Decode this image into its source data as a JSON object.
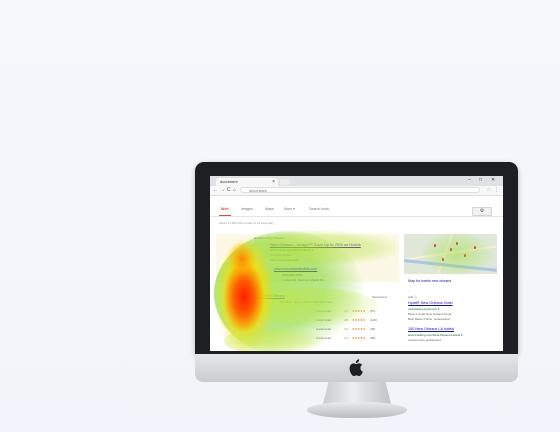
{
  "browser": {
    "tab_title": "document",
    "address": "about:blank",
    "nav_buttons": {
      "back": "←",
      "forward": "→",
      "reload": "C",
      "home": "⌂"
    },
    "window_controls": {
      "minimize": "–",
      "maximize": "□",
      "close": "✕"
    },
    "tab_close": "×",
    "bookmark_icon": "star-icon",
    "menu_icon": "⋮"
  },
  "search": {
    "tabs": [
      "Web",
      "Images",
      "Maps",
      "More ▾",
      "Search tools"
    ],
    "active_tab": "Web",
    "stats": "About 71,000,000 results (0.41 seconds)",
    "gear_icon": "⚙"
  },
  "ad": {
    "header": "Hotels in New Orleans",
    "title": "New Orleans - trivago™ Save Up to 75% on Hotels",
    "url_line": "www.trivago.com/New-Orleans ▾",
    "desc_1": "Compare Hotels",
    "desc_2": "Find your Ideal Hotel!",
    "site": "www.neworleanshotels.com",
    "phone": "(800) 805-5760",
    "address": "1 Hotel Rd, Starting At $119 NL"
  },
  "results": {
    "header": "Hotels in New Orleans",
    "sponsored": "Sponsored",
    "desc": "All hotels, prices, Street View and more",
    "rows": [
      {
        "label": "4-star hotel",
        "rating": "4.4",
        "stars": "★★★★★",
        "count": "(57)"
      },
      {
        "label": "4-star hotel",
        "rating": "4.5",
        "stars": "★★★★★",
        "count": "(120)"
      },
      {
        "label": "4-star hotel",
        "rating": "4.3",
        "stars": "★★★★★",
        "count": "(46)"
      },
      {
        "label": "4-star hotel",
        "rating": "4.1",
        "stars": "★★★★★",
        "count": "(59)"
      }
    ]
  },
  "sidebar": {
    "map_caption": "Map for hotels new orleans",
    "ads_label": "Ads ⓘ",
    "ad1": {
      "title": "Hyatt® New Orleans Hotel",
      "url": "neworleans.hyatt.com ▾",
      "line1": "Book a Hyatt New Orleans Hotel.",
      "line2": "Best Rates Online, Guaranteed."
    },
    "ad2": {
      "title": "150 New Orleans LA hotels",
      "url": "www.booking.com/New-Orleans-Hotels ▾",
      "line1": "Lowest price guaranteed."
    }
  },
  "device": {
    "logo_icon": "apple-logo-icon",
    "logo_glyph": ""
  },
  "colors": {
    "link": "#1a0dab",
    "url_green": "#006621",
    "active_tab": "#dd4b39",
    "heat_hot": "#ff2a00",
    "heat_warm": "#ffe600",
    "heat_cool": "#6cd000"
  }
}
